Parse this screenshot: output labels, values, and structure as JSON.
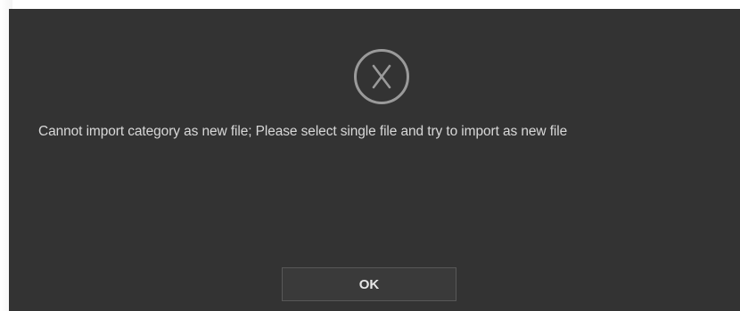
{
  "dialog": {
    "icon": "close-circle-icon",
    "message": "Cannot import category as new file; Please select single file and try to import as new file",
    "ok_label": "OK"
  },
  "colors": {
    "dialog_background": "#333333",
    "text": "#d8d8d8",
    "icon_stroke": "#9a9a9a",
    "button_border": "#585858"
  }
}
